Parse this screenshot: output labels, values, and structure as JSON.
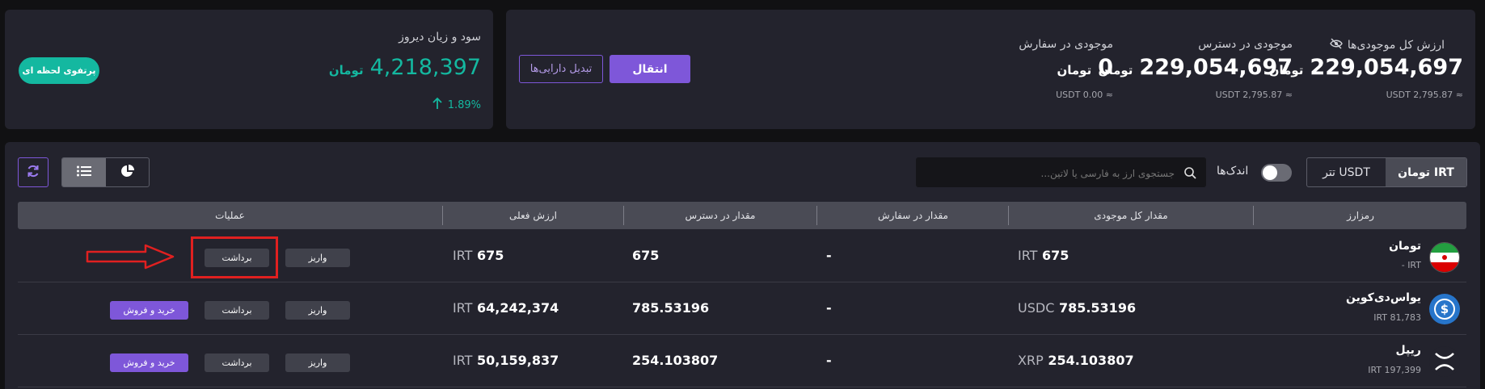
{
  "summary": {
    "total_value": {
      "label": "ارزش کل موجودی‌ها",
      "amount": "229,054,697",
      "unit": "تومان",
      "usdt": "≈ USDT 2,795.87",
      "hide_icon": "eye-off-icon"
    },
    "available": {
      "label": "موجودی در دسترس",
      "amount": "229,054,697",
      "unit": "تومان",
      "usdt": "≈ USDT 2,795.87"
    },
    "in_order": {
      "label": "موجودی در سفارش",
      "amount": "0",
      "unit": "تومان",
      "usdt": "≈ USDT 0.00"
    },
    "transfer_button": "انتقال",
    "convert_button": "تبدیل دارایی‌ها"
  },
  "pnl": {
    "label": "سود و زیان دیروز",
    "amount": "4,218,397",
    "unit": "تومان",
    "percent": "1.89%",
    "instant_portfolio_button": "پرتفوی لحظه ای"
  },
  "toolbar": {
    "tabs": [
      {
        "label": "تومان IRT",
        "active": true
      },
      {
        "label": "تتر USDT",
        "active": false
      }
    ],
    "small_toggle_label": "اندک‌ها",
    "search_placeholder": "جستجوی ارز به فارسی یا لاتین..."
  },
  "table": {
    "headers": {
      "asset": "رمزارز",
      "total": "مقدار کل موجودی",
      "in_order": "مقدار در سفارش",
      "available": "مقدار در دسترس",
      "value": "ارزش فعلی",
      "actions": "عملیات"
    },
    "rows": [
      {
        "name": "تومان",
        "sub": "IRT -",
        "total_amount": "675",
        "total_cur": "IRT",
        "in_order": "-",
        "available": "675",
        "value_amount": "675",
        "value_cur": "IRT",
        "deposit": "واریز",
        "withdraw": "برداشت",
        "trade": ""
      },
      {
        "name": "یواس‌دی‌کوین",
        "sub": "IRT 81,783",
        "total_amount": "785.53196",
        "total_cur": "USDC",
        "in_order": "-",
        "available": "785.53196",
        "value_amount": "64,242,374",
        "value_cur": "IRT",
        "deposit": "واریز",
        "withdraw": "برداشت",
        "trade": "خرید و فروش"
      },
      {
        "name": "ریپل",
        "sub": "IRT 197,399",
        "total_amount": "254.103807",
        "total_cur": "XRP",
        "in_order": "-",
        "available": "254.103807",
        "value_amount": "50,159,837",
        "value_cur": "IRT",
        "deposit": "واریز",
        "withdraw": "برداشت",
        "trade": "خرید و فروش"
      }
    ]
  },
  "colors": {
    "accent": "#7e57d9",
    "teal": "#14b8a0",
    "highlight": "#e02020"
  }
}
